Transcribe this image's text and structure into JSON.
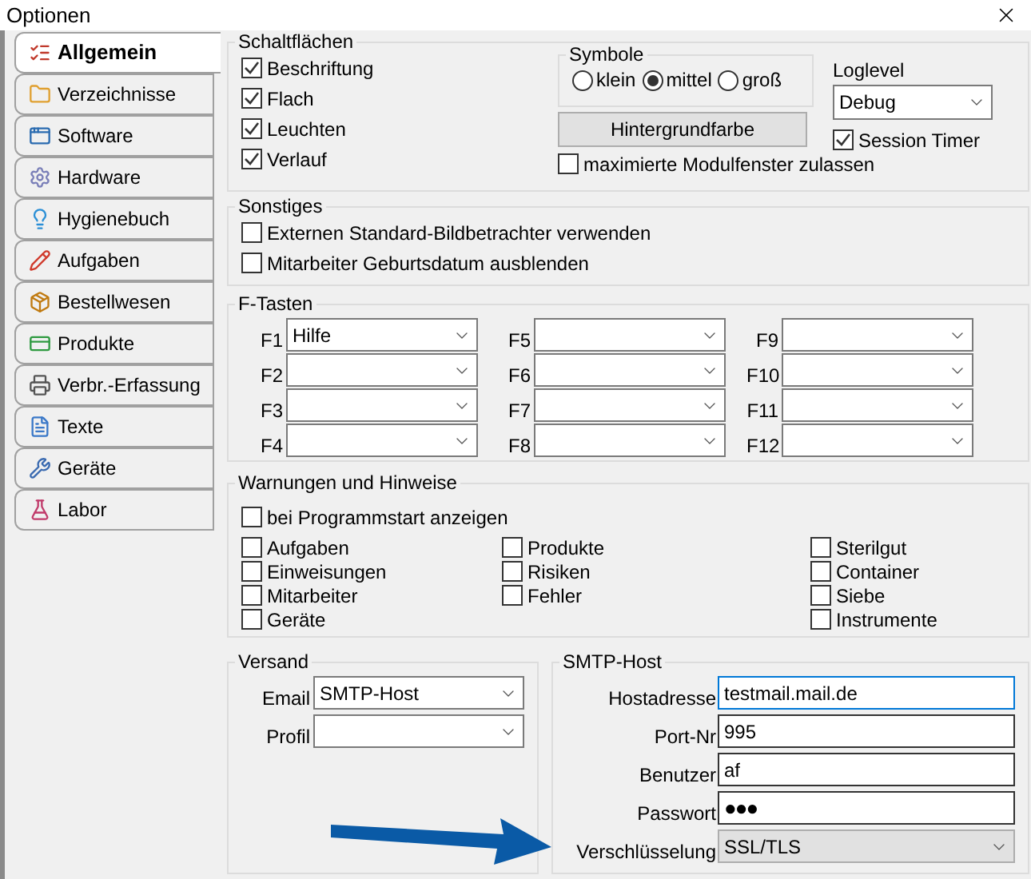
{
  "window": {
    "title": "Optionen"
  },
  "tabs": [
    {
      "label": "Allgemein",
      "selected": true
    },
    {
      "label": "Verzeichnisse",
      "selected": false
    },
    {
      "label": "Software",
      "selected": false
    },
    {
      "label": "Hardware",
      "selected": false
    },
    {
      "label": "Hygienebuch",
      "selected": false
    },
    {
      "label": "Aufgaben",
      "selected": false
    },
    {
      "label": "Bestellwesen",
      "selected": false
    },
    {
      "label": "Produkte",
      "selected": false
    },
    {
      "label": "Verbr.-Erfassung",
      "selected": false
    },
    {
      "label": "Texte",
      "selected": false
    },
    {
      "label": "Geräte",
      "selected": false
    },
    {
      "label": "Labor",
      "selected": false
    }
  ],
  "schaltflaechen": {
    "title": "Schaltflächen",
    "checkboxes": [
      {
        "label": "Beschriftung",
        "checked": true
      },
      {
        "label": "Flach",
        "checked": true
      },
      {
        "label": "Leuchten",
        "checked": true
      },
      {
        "label": "Verlauf",
        "checked": true
      }
    ],
    "symbole": {
      "title": "Symbole",
      "options": [
        {
          "label": "klein",
          "selected": false
        },
        {
          "label": "mittel",
          "selected": true
        },
        {
          "label": "groß",
          "selected": false
        }
      ]
    },
    "color_button": "Hintergrundfarbe",
    "maximize": {
      "label": "maximierte Modulfenster zulassen",
      "checked": false
    },
    "loglevel": {
      "label": "Loglevel",
      "value": "Debug"
    },
    "session_timer": {
      "label": "Session Timer",
      "checked": true
    }
  },
  "sonstiges": {
    "title": "Sonstiges",
    "checkboxes": [
      {
        "label": "Externen Standard-Bildbetrachter verwenden",
        "checked": false
      },
      {
        "label": "Mitarbeiter Geburtsdatum ausblenden",
        "checked": false
      }
    ]
  },
  "f_tasten": {
    "title": "F-Tasten",
    "columns": [
      [
        {
          "label": "F1",
          "value": "Hilfe"
        },
        {
          "label": "F2"
        },
        {
          "label": "F3"
        },
        {
          "label": "F4"
        }
      ],
      [
        {
          "label": "F5"
        },
        {
          "label": "F6"
        },
        {
          "label": "F7"
        },
        {
          "label": "F8"
        }
      ],
      [
        {
          "label": "F9"
        },
        {
          "label": "F10"
        },
        {
          "label": "F11"
        },
        {
          "label": "F12"
        }
      ]
    ]
  },
  "warnungen": {
    "title": "Warnungen und Hinweise",
    "startup": {
      "label": "bei Programmstart anzeigen",
      "checked": false
    },
    "columns": [
      [
        {
          "label": "Aufgaben",
          "checked": false
        },
        {
          "label": "Einweisungen",
          "checked": false
        },
        {
          "label": "Mitarbeiter",
          "checked": false
        },
        {
          "label": "Geräte",
          "checked": false
        }
      ],
      [
        {
          "label": "Produkte",
          "checked": false
        },
        {
          "label": "Risiken",
          "checked": false
        },
        {
          "label": "Fehler",
          "checked": false
        }
      ],
      [
        {
          "label": "Sterilgut",
          "checked": false
        },
        {
          "label": "Container",
          "checked": false
        },
        {
          "label": "Siebe",
          "checked": false
        },
        {
          "label": "Instrumente",
          "checked": false
        }
      ]
    ]
  },
  "versand": {
    "title": "Versand",
    "fields": [
      {
        "label": "Email",
        "value": "SMTP-Host"
      },
      {
        "label": "Profil"
      }
    ]
  },
  "smtp_host": {
    "title": "SMTP-Host",
    "fields": [
      {
        "label": "Hostadresse",
        "value": "testmail.mail.de",
        "kind": "focused"
      },
      {
        "label": "Port-Nr",
        "value": "995",
        "kind": "text"
      },
      {
        "label": "Benutzer",
        "value": "af",
        "kind": "text"
      },
      {
        "label": "Passwort",
        "value": "●●●",
        "kind": "password"
      },
      {
        "label": "Verschlüsselung",
        "value": "SSL/TLS",
        "kind": "select"
      }
    ]
  }
}
